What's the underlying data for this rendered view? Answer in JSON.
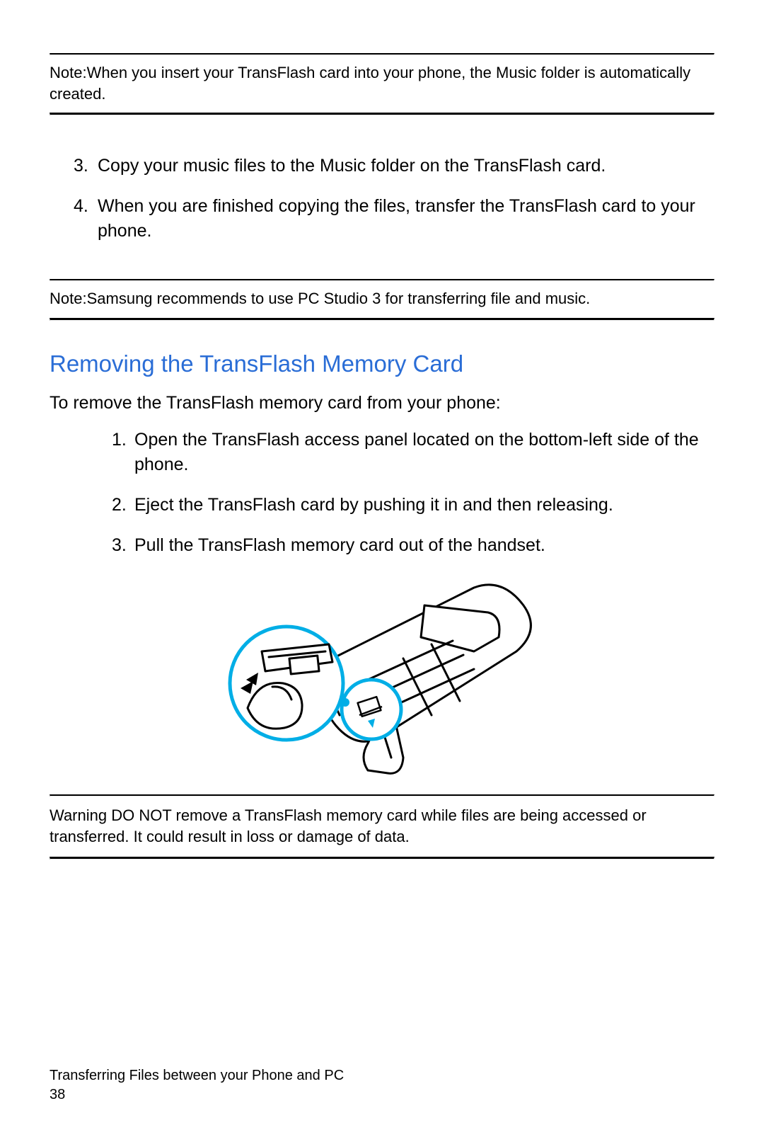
{
  "notes": {
    "top": {
      "label": "Note:",
      "text": "When you insert your TransFlash card into your phone, the Music folder is automatically created."
    },
    "mid": {
      "label": "Note:",
      "text": "Samsung recommends to use PC Studio 3 for transferring file and music."
    }
  },
  "main_list": {
    "item3": {
      "num": "3.",
      "text": "Copy your music files to the Music folder on the TransFlash card."
    },
    "item4": {
      "num": "4.",
      "text": "When you are finished copying the files, transfer the TransFlash card to your phone."
    }
  },
  "section": {
    "heading": "Removing the TransFlash Memory Card",
    "intro": "To remove the TransFlash memory card from your phone:",
    "steps": {
      "s1": {
        "num": "1.",
        "text": "Open the TransFlash access panel located on the bottom-left side of the phone."
      },
      "s2": {
        "num": "2.",
        "text": "Eject the TransFlash card by pushing it in and then releasing."
      },
      "s3": {
        "num": "3.",
        "text": "Pull the TransFlash memory card out of the handset."
      }
    }
  },
  "warning": {
    "label": "Warning",
    "text": " DO NOT remove a TransFlash memory card while files are being accessed or transferred. It could result in loss or damage of data."
  },
  "footer": {
    "chapter": "Transferring Files between your Phone and PC",
    "page": "38"
  },
  "colors": {
    "accent": "#2a6dd6",
    "callout": "#00aee6"
  },
  "illustration": {
    "desc": "phone-line-drawing-with-hand-removing-transflash-card"
  }
}
